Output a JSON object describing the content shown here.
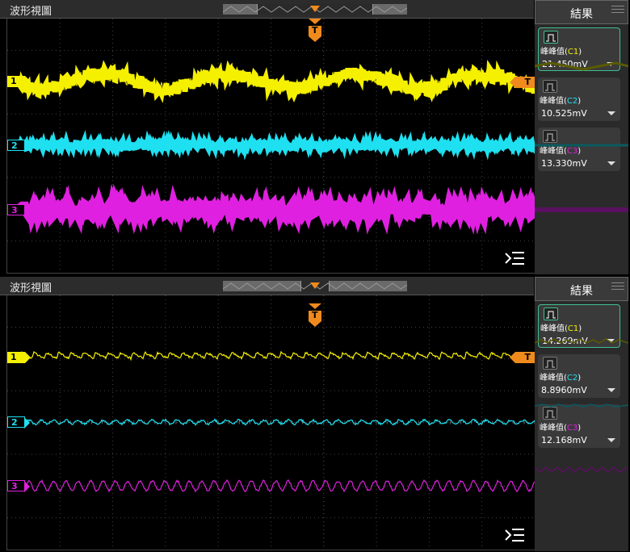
{
  "panels": [
    {
      "title": "波形視圖",
      "results_title": "結果",
      "trigger_marker": "T",
      "trigger_level_label": "T",
      "channels": [
        {
          "label": "1",
          "color": "#f5f000",
          "shape": "sine-slow",
          "amplitude": "large"
        },
        {
          "label": "2",
          "color": "#1ee0f0",
          "shape": "flat-noise"
        },
        {
          "label": "3",
          "color": "#e020e0",
          "shape": "flat-noise"
        }
      ],
      "measurements": [
        {
          "name": "峰峰值",
          "ch_prefix": "(",
          "ch": "C1",
          "ch_suffix": ")",
          "value": "21.450mV"
        },
        {
          "name": "峰峰值",
          "ch_prefix": "(",
          "ch": "C2",
          "ch_suffix": ")",
          "value": "10.525mV"
        },
        {
          "name": "峰峰值",
          "ch_prefix": "(",
          "ch": "C3",
          "ch_suffix": ")",
          "value": "13.330mV"
        }
      ]
    },
    {
      "title": "波形視圖",
      "results_title": "結果",
      "trigger_marker": "T",
      "trigger_level_label": "T",
      "channels": [
        {
          "label": "1",
          "color": "#f5f000",
          "shape": "ripple"
        },
        {
          "label": "2",
          "color": "#1ee0f0",
          "shape": "ripple-small"
        },
        {
          "label": "3",
          "color": "#e020e0",
          "shape": "ripple"
        }
      ],
      "measurements": [
        {
          "name": "峰峰值",
          "ch_prefix": "(",
          "ch": "C1",
          "ch_suffix": ")",
          "value": "14.269mV"
        },
        {
          "name": "峰峰值",
          "ch_prefix": "(",
          "ch": "C2",
          "ch_suffix": ")",
          "value": "8.8960mV"
        },
        {
          "name": "峰峰值",
          "ch_prefix": "(",
          "ch": "C3",
          "ch_suffix": ")",
          "value": "12.168mV"
        }
      ]
    }
  ],
  "icons": {
    "menu": "menu-collapse-icon",
    "measure": "pulse-measure-icon",
    "dropdown": "dropdown-arrow-icon",
    "trigger": "trigger-marker-icon"
  }
}
